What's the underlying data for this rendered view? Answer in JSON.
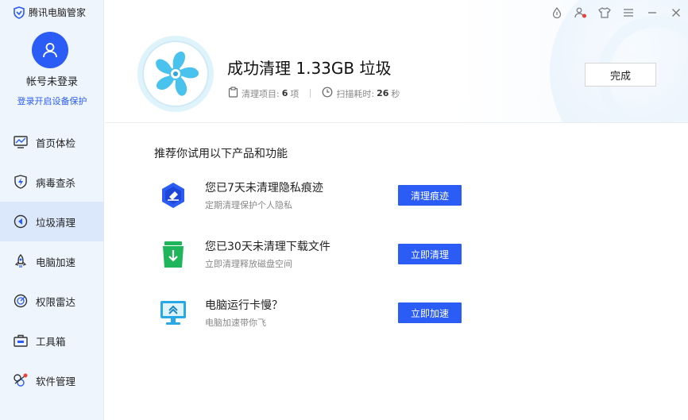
{
  "app": {
    "title": "腾讯电脑管家"
  },
  "user": {
    "name": "帐号未登录",
    "login_link": "登录开启设备保护"
  },
  "nav": [
    {
      "label": "首页体检",
      "icon": "monitor-icon"
    },
    {
      "label": "病毒查杀",
      "icon": "shield-bolt-icon"
    },
    {
      "label": "垃圾清理",
      "icon": "broom-icon",
      "active": true
    },
    {
      "label": "电脑加速",
      "icon": "rocket-icon"
    },
    {
      "label": "权限雷达",
      "icon": "radar-icon"
    },
    {
      "label": "工具箱",
      "icon": "toolbox-icon"
    },
    {
      "label": "软件管理",
      "icon": "apps-icon"
    }
  ],
  "result": {
    "title": "成功清理 1.33GB 垃圾",
    "items_label": "清理项目:",
    "items_value": "6",
    "items_unit": "项",
    "time_label": "扫描耗时:",
    "time_value": "26",
    "time_unit": "秒",
    "done_label": "完成"
  },
  "recommend": {
    "heading": "推荐你试用以下产品和功能",
    "items": [
      {
        "title": "您已7天未清理隐私痕迹",
        "subtitle": "定期清理保护个人隐私",
        "button": "清理痕迹",
        "icon": "eraser-icon"
      },
      {
        "title": "您已30天未清理下载文件",
        "subtitle": "立即清理释放磁盘空间",
        "button": "立即清理",
        "icon": "trash-download-icon"
      },
      {
        "title": "电脑运行卡慢？",
        "subtitle": "电脑加速带你飞",
        "button": "立即加速",
        "icon": "monitor-speed-icon"
      }
    ]
  },
  "colors": {
    "accent": "#2b5cf6",
    "sidebar_bg": "#eef5fd",
    "active_bg": "#dbe8fb",
    "green": "#1fb55b",
    "red_dot": "#e8443a"
  }
}
